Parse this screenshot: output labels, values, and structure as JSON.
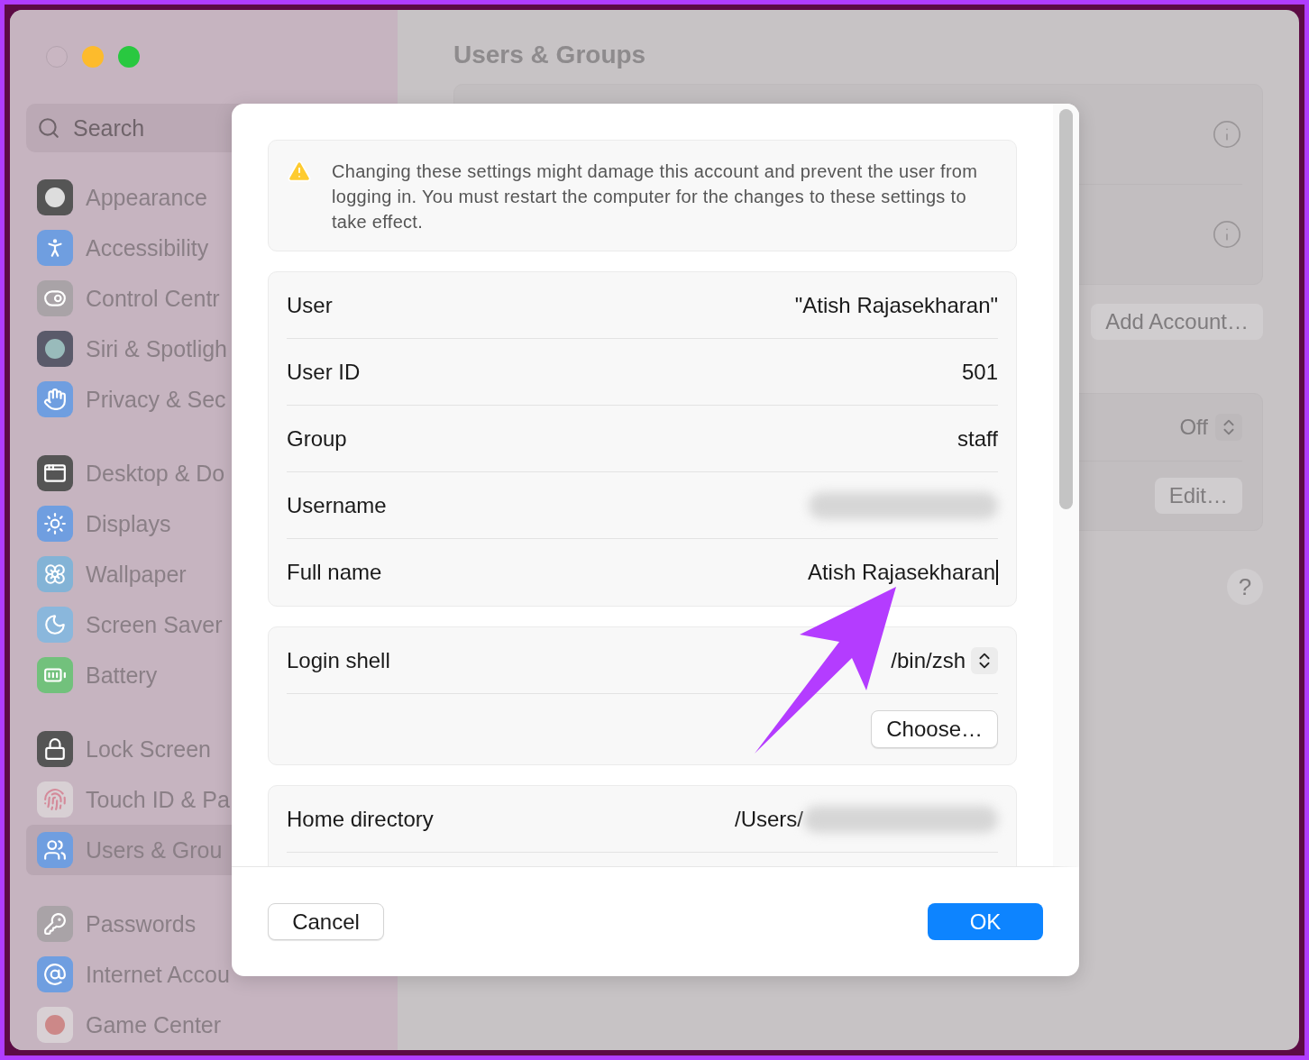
{
  "sidebar": {
    "search": {
      "placeholder": "Search"
    },
    "groups": [
      [
        {
          "label": "Appearance",
          "selected": false
        },
        {
          "label": "Accessibility",
          "selected": false
        },
        {
          "label": "Control Centr",
          "selected": false
        },
        {
          "label": "Siri & Spotligh",
          "selected": false
        },
        {
          "label": "Privacy & Sec",
          "selected": false
        }
      ],
      [
        {
          "label": "Desktop & Do",
          "selected": false
        },
        {
          "label": "Displays",
          "selected": false
        },
        {
          "label": "Wallpaper",
          "selected": false
        },
        {
          "label": "Screen Saver",
          "selected": false
        },
        {
          "label": "Battery",
          "selected": false
        }
      ],
      [
        {
          "label": "Lock Screen",
          "selected": false
        },
        {
          "label": "Touch ID & Pa",
          "selected": false
        },
        {
          "label": "Users & Grou",
          "selected": true
        }
      ],
      [
        {
          "label": "Passwords",
          "selected": false
        },
        {
          "label": "Internet Accou",
          "selected": false
        },
        {
          "label": "Game Center",
          "selected": false
        }
      ]
    ]
  },
  "main": {
    "title": "Users & Groups",
    "add_account_button": "Add Account…",
    "popup_value": "Off",
    "edit_button": "Edit…",
    "help_button": "?"
  },
  "dialog": {
    "warning": "Changing these settings might damage this account and prevent the user from logging in. You must restart the computer for the changes to these settings to take effect.",
    "rows": [
      {
        "kind": "text",
        "label": "User",
        "value": "\"Atish Rajasekharan\""
      },
      {
        "kind": "text",
        "label": "User ID",
        "value": "501"
      },
      {
        "kind": "text",
        "label": "Group",
        "value": "staff"
      },
      {
        "kind": "blurred",
        "label": "Username"
      },
      {
        "kind": "field",
        "label": "Full name",
        "value": "Atish Rajasekharan"
      }
    ],
    "shell": {
      "label": "Login shell",
      "value": "/bin/zsh",
      "button": "Choose…"
    },
    "home": {
      "label": "Home directory",
      "value": "/Users/"
    },
    "cancel_button": "Cancel",
    "ok_button": "OK"
  }
}
